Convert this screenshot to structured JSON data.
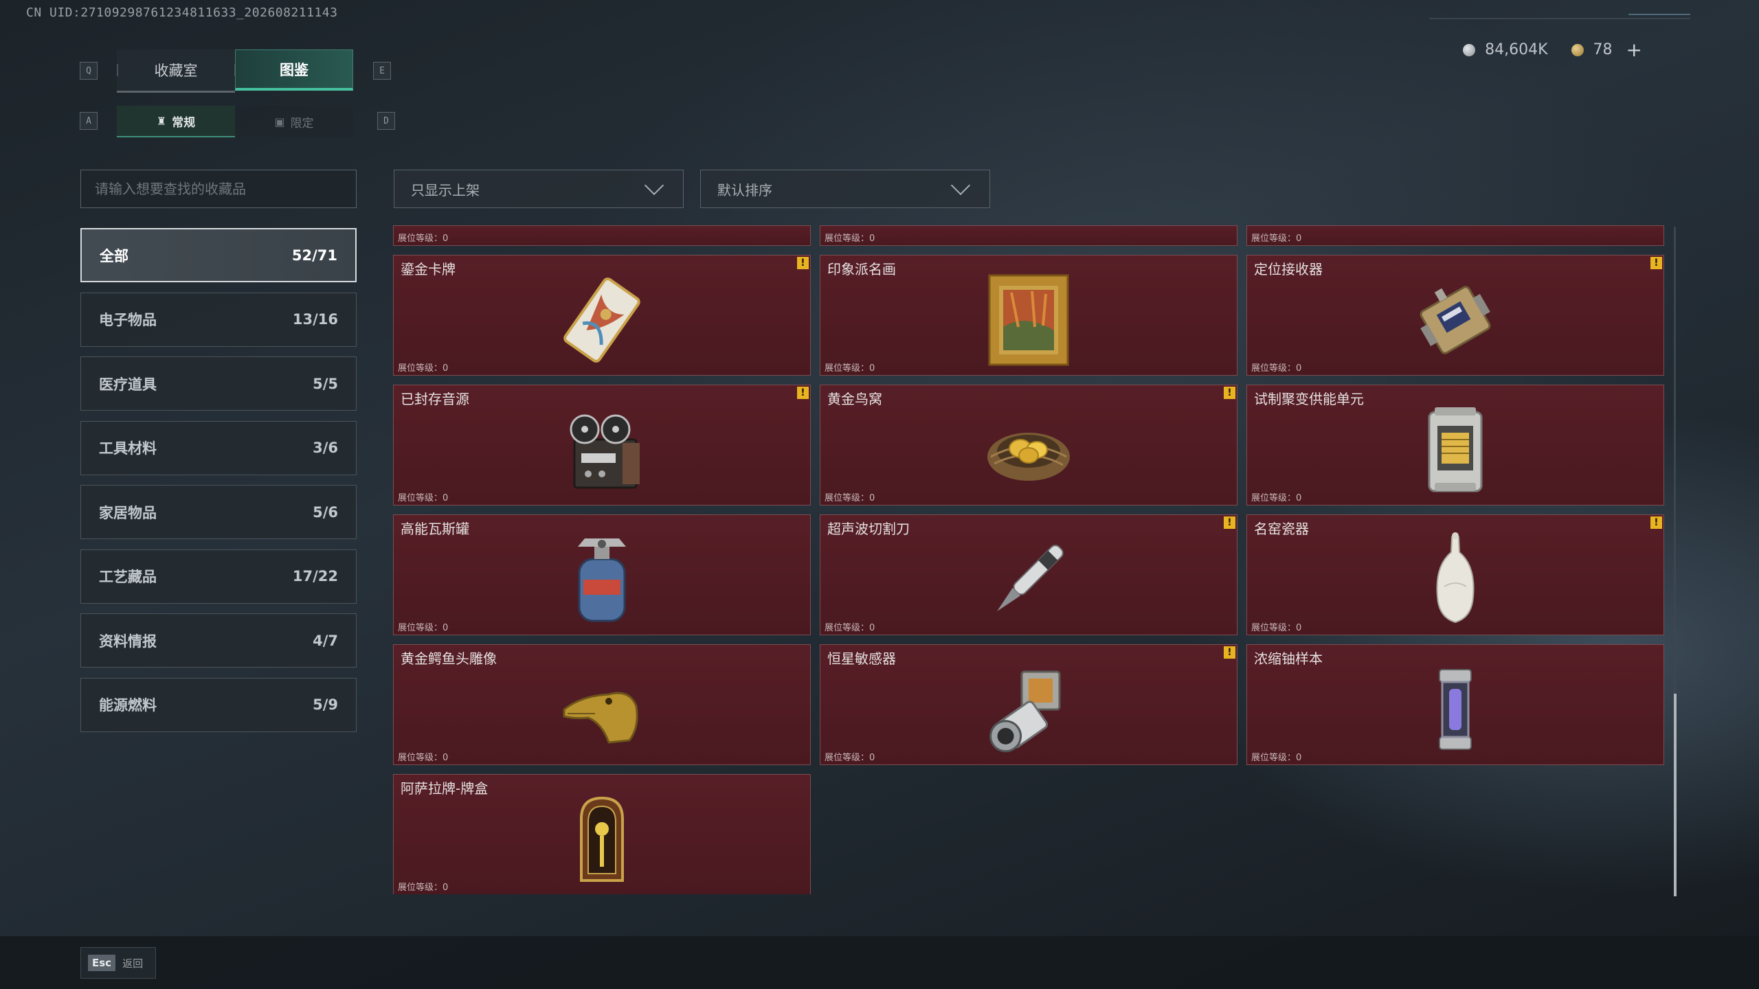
{
  "uid_text": "CN UID:27109298761234811633_202608211143",
  "currency": {
    "silver": "84,604K",
    "gold": "78",
    "plus": "+"
  },
  "keys": {
    "prev_tab": "Q",
    "next_tab": "E",
    "prev_sub": "A",
    "next_sub": "D"
  },
  "tabs": [
    {
      "label": "收藏室",
      "active": false
    },
    {
      "label": "图鉴",
      "active": true
    }
  ],
  "subtabs": [
    {
      "label": "常规",
      "icon": "bottle-icon",
      "active": true
    },
    {
      "label": "限定",
      "icon": "image-icon",
      "active": false
    }
  ],
  "search": {
    "placeholder": "请输入想要查找的收藏品"
  },
  "filters": {
    "shelf": "只显示上架",
    "sort": "默认排序"
  },
  "categories": [
    {
      "label": "全部",
      "count": "52/71",
      "active": true
    },
    {
      "label": "电子物品",
      "count": "13/16",
      "active": false
    },
    {
      "label": "医疗道具",
      "count": "5/5",
      "active": false
    },
    {
      "label": "工具材料",
      "count": "3/6",
      "active": false
    },
    {
      "label": "家居物品",
      "count": "5/6",
      "active": false
    },
    {
      "label": "工艺藏品",
      "count": "17/22",
      "active": false
    },
    {
      "label": "资料情报",
      "count": "4/7",
      "active": false
    },
    {
      "label": "能源燃料",
      "count": "5/9",
      "active": false
    }
  ],
  "level_label": "展位等级：0",
  "partial_row": [
    "展位等级：0",
    "展位等级：0",
    "展位等级：0"
  ],
  "items": [
    {
      "name": "鎏金卡牌",
      "warn": true,
      "icon": "gilded-card-icon"
    },
    {
      "name": "印象派名画",
      "warn": false,
      "icon": "framed-painting-icon"
    },
    {
      "name": "定位接收器",
      "warn": true,
      "icon": "locator-receiver-icon"
    },
    {
      "name": "已封存音源",
      "warn": true,
      "icon": "reel-tape-recorder-icon"
    },
    {
      "name": "黄金鸟窝",
      "warn": true,
      "icon": "golden-nest-icon"
    },
    {
      "name": "试制聚变供能单元",
      "warn": false,
      "icon": "fusion-unit-icon"
    },
    {
      "name": "高能瓦斯罐",
      "warn": false,
      "icon": "gas-canister-icon"
    },
    {
      "name": "超声波切割刀",
      "warn": true,
      "icon": "ultrasonic-knife-icon"
    },
    {
      "name": "名窑瓷器",
      "warn": true,
      "icon": "porcelain-vase-icon"
    },
    {
      "name": "黄金鳄鱼头雕像",
      "warn": false,
      "icon": "golden-crocodile-icon"
    },
    {
      "name": "恒星敏感器",
      "warn": true,
      "icon": "star-sensor-icon"
    },
    {
      "name": "浓缩铀样本",
      "warn": false,
      "icon": "uranium-sample-icon"
    },
    {
      "name": "阿萨拉牌-牌盒",
      "warn": false,
      "icon": "card-box-icon"
    }
  ],
  "warn_symbol": "!",
  "bottom": {
    "esc_key": "Esc",
    "esc_label": "返回"
  }
}
